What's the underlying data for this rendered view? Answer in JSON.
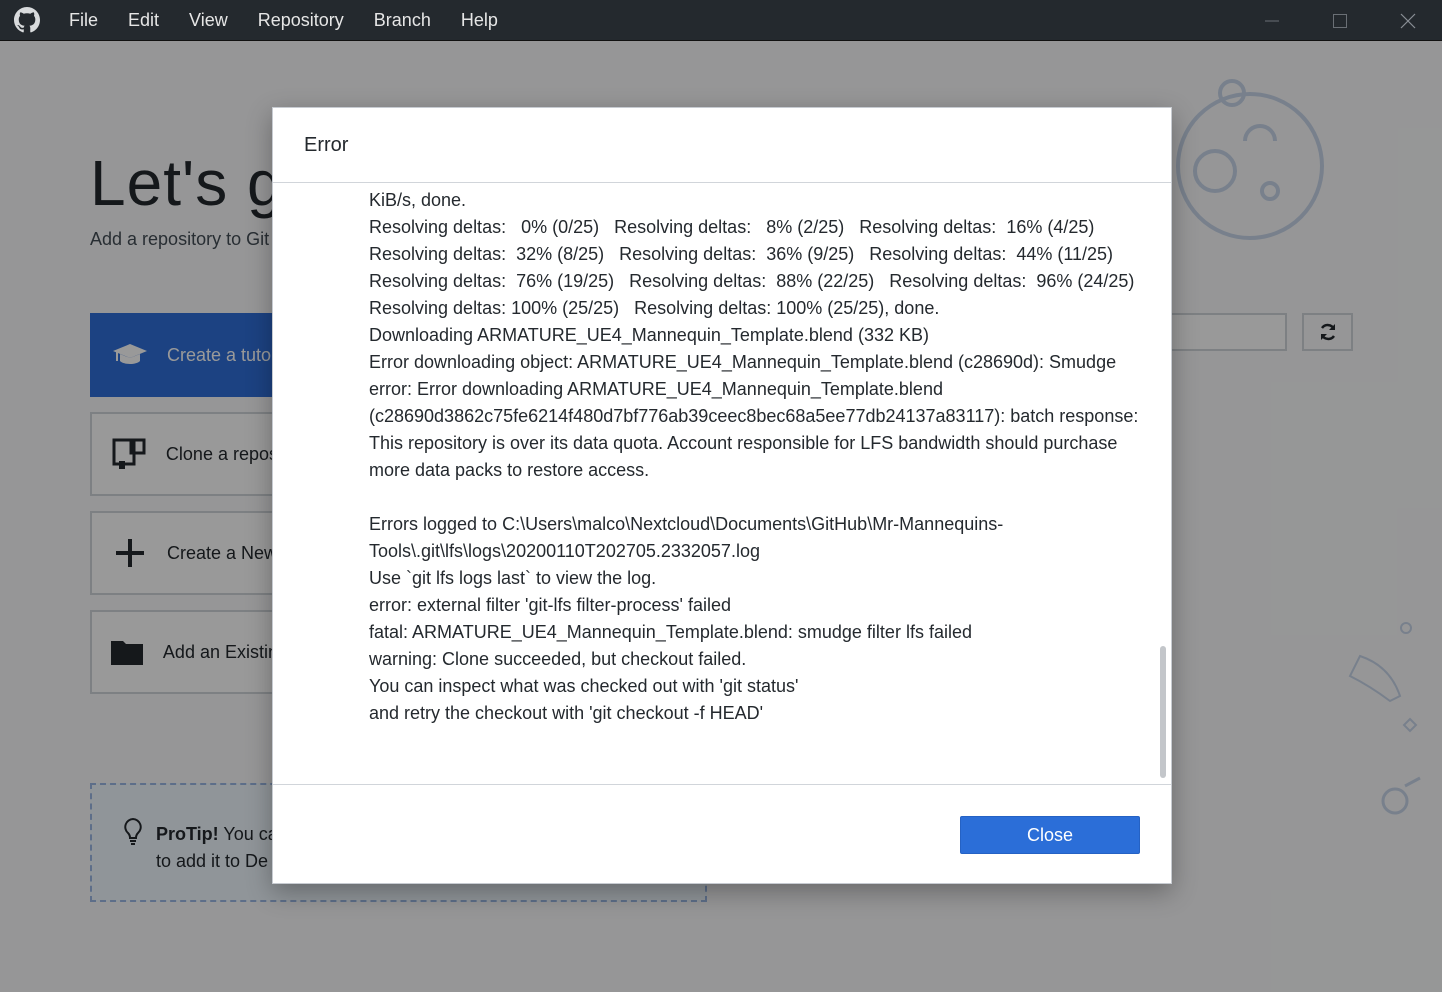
{
  "menu": {
    "items": [
      "File",
      "Edit",
      "View",
      "Repository",
      "Branch",
      "Help"
    ]
  },
  "welcome": {
    "title": "Let's get",
    "subtitle": "Add a repository to Git",
    "actions": [
      {
        "label": "Create a tutor",
        "icon": "graduation-cap-icon"
      },
      {
        "label": "Clone a repos",
        "icon": "clone-repo-icon"
      },
      {
        "label": "Create a New",
        "icon": "plus-icon"
      },
      {
        "label": "Add an Existin",
        "icon": "folder-icon"
      }
    ],
    "protip": {
      "bold": "ProTip!",
      "line1": " You ca",
      "line2": "to add it to De"
    }
  },
  "dialog": {
    "title": "Error",
    "log_lines": [
      "KiB/s, done.",
      "Resolving deltas:   0% (0/25)   Resolving deltas:   8% (2/25)   Resolving deltas:  16% (4/25)",
      "Resolving deltas:  32% (8/25)   Resolving deltas:  36% (9/25)   Resolving deltas:  44% (11/25)",
      "Resolving deltas:  76% (19/25)   Resolving deltas:  88% (22/25)   Resolving deltas:  96% (24/25)",
      "Resolving deltas: 100% (25/25)   Resolving deltas: 100% (25/25), done.",
      "Downloading ARMATURE_UE4_Mannequin_Template.blend (332 KB)",
      "Error downloading object: ARMATURE_UE4_Mannequin_Template.blend (c28690d): Smudge",
      "error: Error downloading ARMATURE_UE4_Mannequin_Template.blend",
      "(c28690d3862c75fe6214f480d7bf776ab39ceec8bec68a5ee77db24137a83117): batch response:",
      "This repository is over its data quota. Account responsible for LFS bandwidth should purchase",
      "more data packs to restore access.",
      "",
      "Errors logged to C:\\Users\\malco\\Nextcloud\\Documents\\GitHub\\Mr-Mannequins-",
      "Tools\\.git\\lfs\\logs\\20200110T202705.2332057.log",
      "Use `git lfs logs last` to view the log.",
      "error: external filter 'git-lfs filter-process' failed",
      "fatal: ARMATURE_UE4_Mannequin_Template.blend: smudge filter lfs failed",
      "warning: Clone succeeded, but checkout failed.",
      "You can inspect what was checked out with 'git status'",
      "and retry the checkout with 'git checkout -f HEAD'"
    ],
    "close_label": "Close"
  },
  "colors": {
    "titlebar": "#24292e",
    "primary": "#2b6ed8",
    "overlay": "rgba(0,0,0,0.40)"
  }
}
